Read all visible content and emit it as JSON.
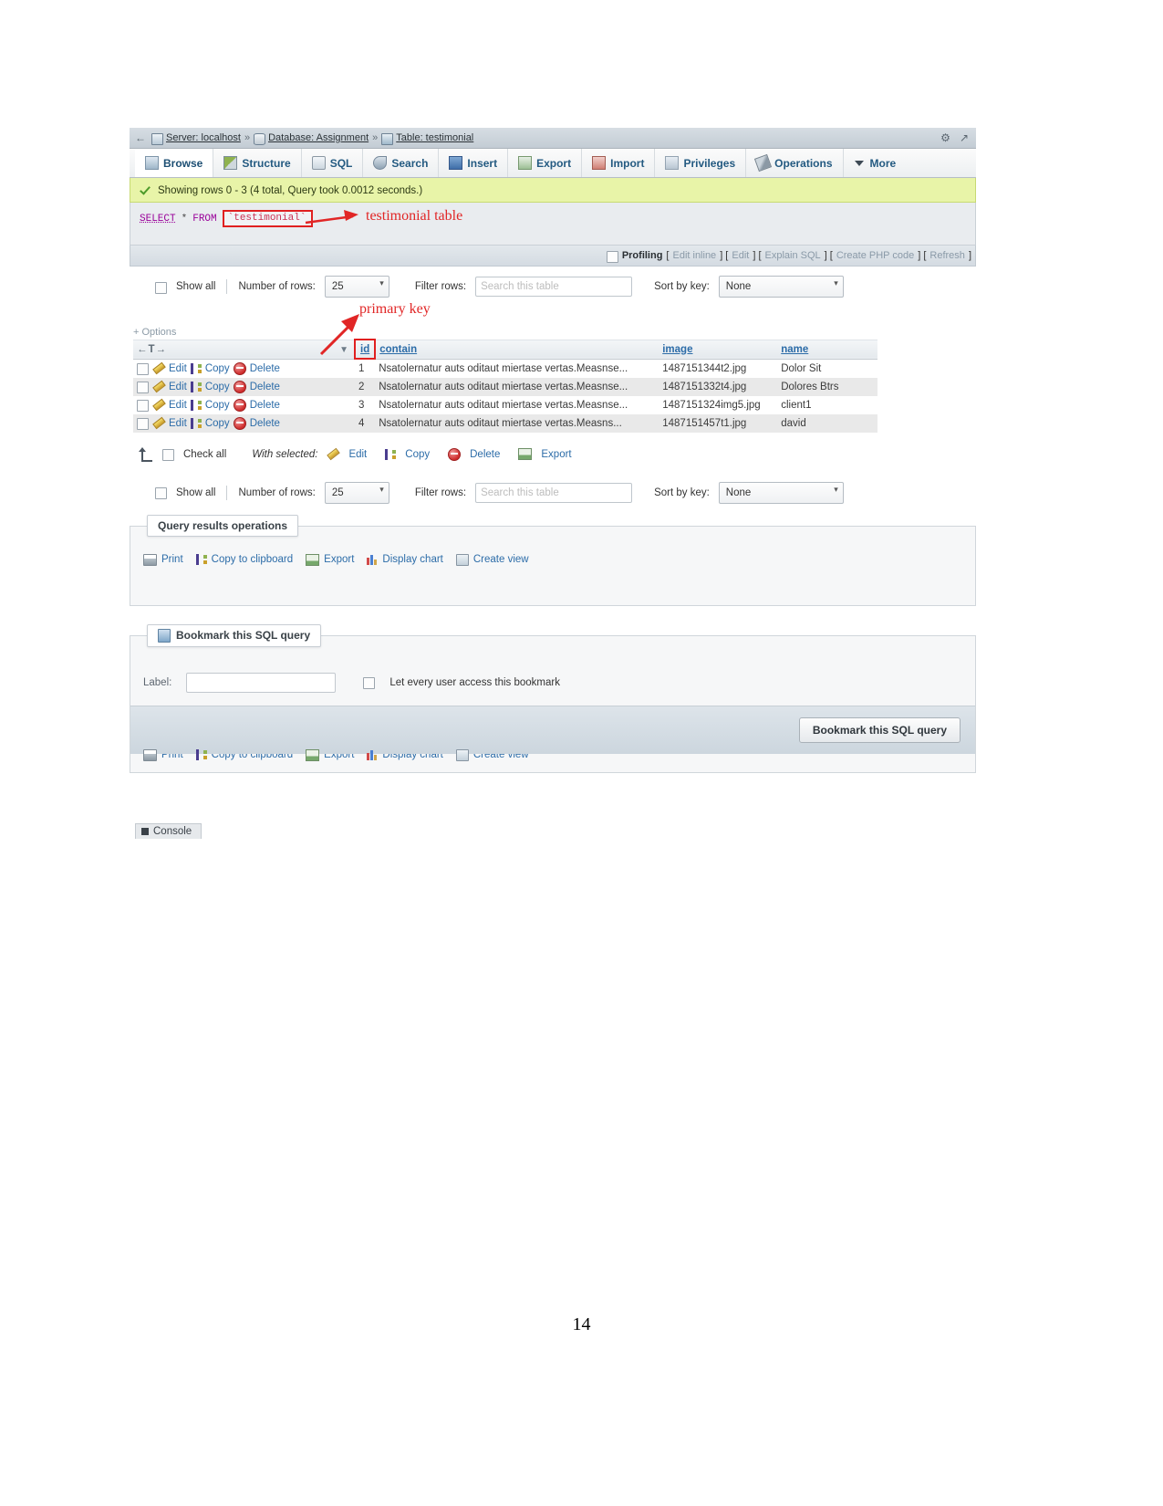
{
  "page": {
    "number": "14"
  },
  "breadcrumb": {
    "back_icon": "back-arrow-icon",
    "server": "Server: localhost",
    "database": "Database: Assignment",
    "table": "Table: testimonial",
    "sep": "»"
  },
  "tabs": [
    {
      "label": "Browse",
      "icon": "browse-icon",
      "active": true
    },
    {
      "label": "Structure",
      "icon": "structure-icon",
      "active": false
    },
    {
      "label": "SQL",
      "icon": "sql-icon",
      "active": false
    },
    {
      "label": "Search",
      "icon": "search-icon",
      "active": false
    },
    {
      "label": "Insert",
      "icon": "insert-icon",
      "active": false
    },
    {
      "label": "Export",
      "icon": "export-icon",
      "active": false
    },
    {
      "label": "Import",
      "icon": "import-icon",
      "active": false
    },
    {
      "label": "Privileges",
      "icon": "privileges-icon",
      "active": false
    },
    {
      "label": "Operations",
      "icon": "operations-icon",
      "active": false
    },
    {
      "label": "More",
      "icon": "chevron-down-icon",
      "active": false
    }
  ],
  "status": {
    "icon": "success-check-icon",
    "message": "Showing rows 0 - 3 (4 total, Query took 0.0012 seconds.)"
  },
  "sql": {
    "select": "SELECT",
    "star": "*",
    "from": "FROM",
    "table": "`testimonial`"
  },
  "annotations": {
    "table_note": "testimonial table",
    "primary_key_note": "primary key"
  },
  "profiling": {
    "label": "Profiling",
    "links": [
      "Edit inline",
      "Edit",
      "Explain SQL",
      "Create PHP code",
      "Refresh"
    ]
  },
  "controls": {
    "show_all": "Show all",
    "number_of_rows_label": "Number of rows:",
    "number_of_rows_value": "25",
    "filter_rows_label": "Filter rows:",
    "filter_placeholder": "Search this table",
    "sort_by_key_label": "Sort by key:",
    "sort_by_key_value": "None"
  },
  "options_link": "Options",
  "table": {
    "nav_icons": [
      "arrow-left-icon",
      "t-icon",
      "arrow-right-icon"
    ],
    "sort_caret": "▼",
    "columns": [
      "id",
      "contain",
      "image",
      "name"
    ],
    "row_actions": [
      "Edit",
      "Copy",
      "Delete"
    ],
    "rows": [
      {
        "id": "1",
        "contain": "Nsatolernatur auts oditaut miertase vertas.Measnse...",
        "image": "1487151344t2.jpg",
        "name": "Dolor Sit"
      },
      {
        "id": "2",
        "contain": "Nsatolernatur auts oditaut miertase vertas.Measnse...",
        "image": "1487151332t4.jpg",
        "name": "Dolores Btrs"
      },
      {
        "id": "3",
        "contain": "Nsatolernatur auts oditaut miertase vertas.Measnse...",
        "image": "1487151324img5.jpg",
        "name": "client1"
      },
      {
        "id": "4",
        "contain": "Nsatolernatur auts oditaut miertase vertas.Measns...",
        "image": "1487151457t1.jpg",
        "name": "david"
      }
    ]
  },
  "with_selected": {
    "check_all": "Check all",
    "label": "With selected:",
    "actions": [
      "Edit",
      "Copy",
      "Delete",
      "Export"
    ]
  },
  "query_results_operations": {
    "legend": "Query results operations",
    "actions": [
      "Print",
      "Copy to clipboard",
      "Export",
      "Display chart",
      "Create view"
    ]
  },
  "bookmark": {
    "legend": "Bookmark this SQL query",
    "label": "Label:",
    "label_value": "",
    "checkbox_label": "Let every user access this bookmark",
    "submit": "Bookmark this SQL query"
  },
  "bottom_operations": {
    "actions": [
      "Print",
      "Copy to clipboard",
      "Export",
      "Display chart",
      "Create view"
    ]
  },
  "console": {
    "label": "Console",
    "icon": "console-icon"
  },
  "colors": {
    "accent_link": "#2c6ca8",
    "success_bg": "#e8f4a8",
    "annotation_red": "#e12626"
  }
}
